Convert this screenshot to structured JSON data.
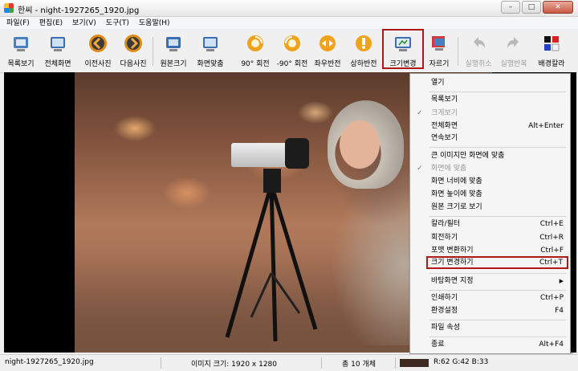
{
  "window": {
    "title": "한씨 - night-1927265_1920.jpg",
    "minimize": "–",
    "maximize": "□",
    "close": "✕"
  },
  "menu": [
    "파일(F)",
    "편집(E)",
    "보기(V)",
    "도구(T)",
    "도움말(H)"
  ],
  "toolbar": [
    {
      "label": "목록보기",
      "icon": "list-view-icon"
    },
    {
      "label": "전체화면",
      "icon": "fullscreen-icon"
    },
    {
      "label": "이전사진",
      "icon": "prev-arrow-icon"
    },
    {
      "label": "다음사진",
      "icon": "next-arrow-icon"
    },
    {
      "label": "원본크기",
      "icon": "original-size-icon"
    },
    {
      "label": "화면맞춤",
      "icon": "fit-screen-icon"
    },
    {
      "label": "90° 회전",
      "icon": "rotate-cw-icon"
    },
    {
      "label": "-90° 회전",
      "icon": "rotate-ccw-icon"
    },
    {
      "label": "좌우반전",
      "icon": "flip-horizontal-icon"
    },
    {
      "label": "상하반전",
      "icon": "flip-vertical-icon"
    },
    {
      "label": "크기변경",
      "icon": "resize-icon"
    },
    {
      "label": "자르기",
      "icon": "crop-icon"
    },
    {
      "label": "실행취소",
      "icon": "undo-icon"
    },
    {
      "label": "실행반복",
      "icon": "redo-icon"
    },
    {
      "label": "배경칼라",
      "icon": "background-color-icon"
    }
  ],
  "context_menu": [
    {
      "label": "열기",
      "shortcut": ""
    },
    {
      "label": "목록보기",
      "shortcut": ""
    },
    {
      "label": "크게보기",
      "shortcut": "",
      "checked": true,
      "disabled": true
    },
    {
      "label": "전체화면",
      "shortcut": "Alt+Enter"
    },
    {
      "label": "연속보기",
      "shortcut": ""
    },
    {
      "label": "큰 이미지만 화면에 맞춤",
      "shortcut": ""
    },
    {
      "label": "화면에 맞춤",
      "shortcut": "",
      "checked": true,
      "disabled": true
    },
    {
      "label": "화면 너비에 맞춤",
      "shortcut": ""
    },
    {
      "label": "화면 높이에 맞춤",
      "shortcut": ""
    },
    {
      "label": "원본 크기로 보기",
      "shortcut": ""
    },
    {
      "label": "칼라/필터",
      "shortcut": "Ctrl+E"
    },
    {
      "label": "회전하기",
      "shortcut": "Ctrl+R"
    },
    {
      "label": "포맷 변환하기",
      "shortcut": "Ctrl+F"
    },
    {
      "label": "크기 변경하기",
      "shortcut": "Ctrl+T",
      "highlight": true
    },
    {
      "label": "바탕화면 지정",
      "shortcut": "",
      "submenu": "▶"
    },
    {
      "label": "인쇄하기",
      "shortcut": "Ctrl+P"
    },
    {
      "label": "환경설정",
      "shortcut": "F4"
    },
    {
      "label": "파일 속성",
      "shortcut": ""
    },
    {
      "label": "종료",
      "shortcut": "Alt+F4"
    }
  ],
  "status": {
    "filename": "night-1927265_1920.jpg",
    "image_size": "이미지 크기: 1920 x 1280",
    "count": "총 10 개체",
    "color_value": "R:62 G:42 B:33",
    "swatch_color": "#3e2a21"
  },
  "colors": {
    "highlight_border": "#b01818",
    "menu_bg": "#f5f5f5"
  }
}
